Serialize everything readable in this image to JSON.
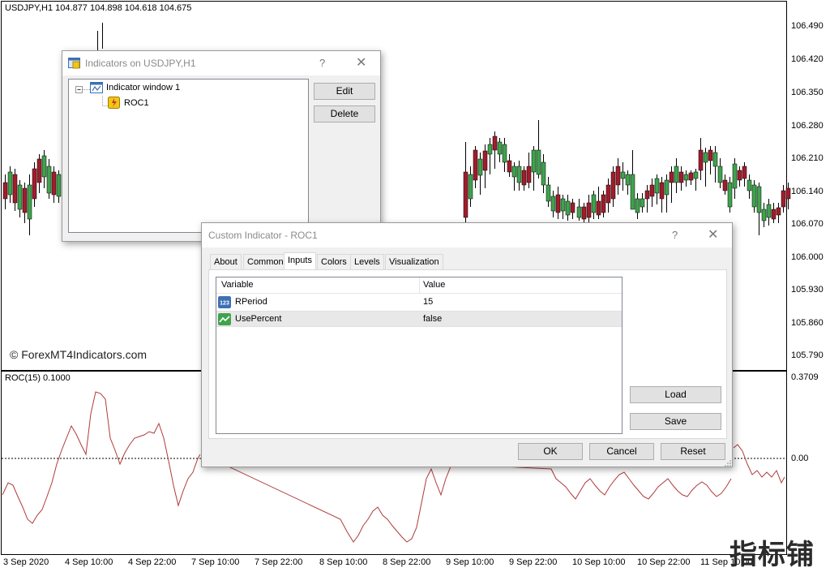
{
  "chart": {
    "title": "USDJPY,H1  104.877 104.898 104.618 104.675",
    "indicator_title": "ROC(15) 0.1000",
    "watermark": "© ForexMT4Indicators.com",
    "brand_stamp": "指标铺",
    "price_axis": [
      "106.490",
      "106.420",
      "106.350",
      "106.280",
      "106.210",
      "106.140",
      "106.070",
      "106.000",
      "105.930",
      "105.860",
      "105.790"
    ],
    "indicator_axis": [
      "0.3709",
      "0.00"
    ],
    "time_axis": [
      "3 Sep 2020",
      "4 Sep 10:00",
      "4 Sep 22:00",
      "7 Sep 10:00",
      "7 Sep 22:00",
      "8 Sep 10:00",
      "8 Sep 22:00",
      "9 Sep 10:00",
      "9 Sep 22:00",
      "10 Sep 10:00",
      "10 Sep 22:00",
      "11 Sep 10:00"
    ],
    "colors": {
      "bull": "#3fa34d",
      "bear": "#a11d2b",
      "roc_line": "#b03a3a",
      "grid": "#000000"
    }
  },
  "indicators_dialog": {
    "title": "Indicators on USDJPY,H1",
    "help_icon": "?",
    "close_icon": "✕",
    "tree": [
      {
        "label": "Indicator window 1",
        "icon": "indicator-window-icon"
      },
      {
        "label": "ROC1",
        "icon": "custom-indicator-icon"
      }
    ],
    "buttons": {
      "edit": "Edit",
      "delete": "Delete"
    }
  },
  "custom_dialog": {
    "title": "Custom Indicator - ROC1",
    "help_icon": "?",
    "close_icon": "✕",
    "tabs": [
      "About",
      "Common",
      "Inputs",
      "Colors",
      "Levels",
      "Visualization"
    ],
    "active_tab": "Inputs",
    "table": {
      "headers": {
        "variable": "Variable",
        "value": "Value"
      },
      "rows": [
        {
          "variable": "RPeriod",
          "value": "15",
          "icon": "integer-param-icon",
          "icon_text": "123"
        },
        {
          "variable": "UsePercent",
          "value": "false",
          "icon": "bool-param-icon"
        }
      ]
    },
    "buttons": {
      "load": "Load",
      "save": "Save",
      "ok": "OK",
      "cancel": "Cancel",
      "reset": "Reset"
    }
  }
}
